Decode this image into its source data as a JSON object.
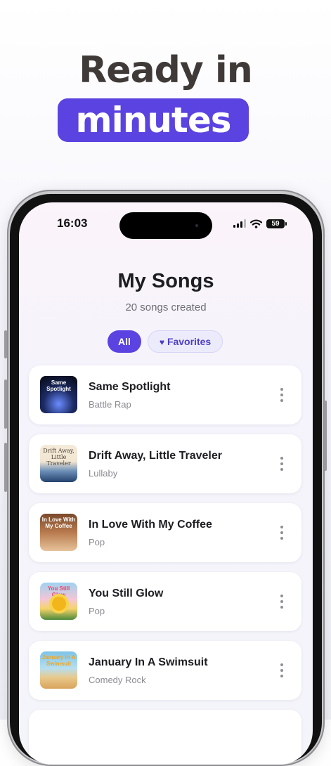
{
  "headline": {
    "line1": "Ready in",
    "line2": "minutes"
  },
  "status_bar": {
    "time": "16:03",
    "battery": "59"
  },
  "header": {
    "title": "My Songs",
    "subtitle": "20 songs created"
  },
  "filters": {
    "all": "All",
    "favorites": "Favorites"
  },
  "songs": [
    {
      "title": "Same Spotlight",
      "genre": "Battle Rap",
      "art_text": "Same Spotlight"
    },
    {
      "title": "Drift Away, Little Traveler",
      "genre": "Lullaby",
      "art_text": "Drift Away, Little Traveler"
    },
    {
      "title": "In Love With My Coffee",
      "genre": "Pop",
      "art_text": "In Love With My Coffee"
    },
    {
      "title": "You Still Glow",
      "genre": "Pop",
      "art_text": "You Still Glow"
    },
    {
      "title": "January In A Swimsuit",
      "genre": "Comedy Rock",
      "art_text": "January In A Swimsuit"
    }
  ],
  "colors": {
    "accent": "#5a43e0",
    "headline": "#3f3a37"
  }
}
